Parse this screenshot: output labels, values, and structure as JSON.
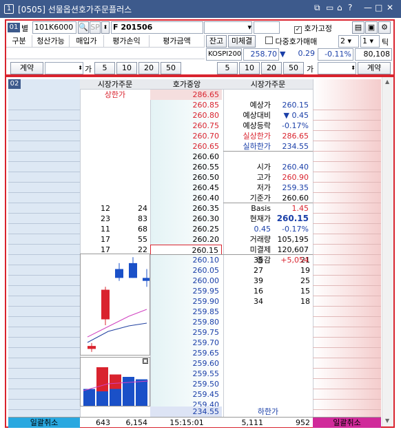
{
  "window": {
    "title": "[0505] 선물옵션호가주문플러스",
    "number": "1"
  },
  "toolbar": {
    "badge": "01",
    "code_label": "별",
    "code_value": "101K6000",
    "contract": "F 201506",
    "hoga_fixed_label": "호가고정",
    "multi_label": "다중호가매매",
    "multi_val1": "2",
    "multi_val2": "1",
    "tick_label": "틱",
    "btn_jango": "잔고",
    "btn_michegyeol": "미체결"
  },
  "summary_headers": [
    "구분",
    "청산가능",
    "매입가",
    "평가손익",
    "평가금액"
  ],
  "kospi": {
    "label": "KOSPI200",
    "value": "258.70",
    "change": "0.29",
    "rate": "-0.11%",
    "volume": "80,108"
  },
  "qty_row": {
    "left_label": "계약",
    "left_unit": "가",
    "qtys": [
      "5",
      "10",
      "20",
      "50"
    ],
    "right_qtys": [
      "5",
      "10",
      "20",
      "50"
    ],
    "right_unit": "가",
    "right_label": "계약"
  },
  "board": {
    "badge": "02",
    "headers": [
      "시장가주문",
      "호가중앙",
      "시장가주문"
    ],
    "upper_limit_label": "상한가",
    "upper_limit": "286.65",
    "lower_limit_label": "하한가",
    "lower_limit": "234.55",
    "prices": [
      "260.85",
      "260.80",
      "260.75",
      "260.70",
      "260.65",
      "260.60",
      "260.55",
      "260.50",
      "260.45",
      "260.40",
      "260.35",
      "260.30",
      "260.25",
      "260.20",
      "260.15",
      "260.10",
      "260.05",
      "260.00",
      "259.95",
      "259.90",
      "259.85",
      "259.80",
      "259.75",
      "259.70",
      "259.65",
      "259.60",
      "259.55",
      "259.50",
      "259.45",
      "259.40"
    ],
    "ask_rows": [
      {
        "cnt": "12",
        "qty": "24"
      },
      {
        "cnt": "23",
        "qty": "83"
      },
      {
        "cnt": "11",
        "qty": "68"
      },
      {
        "cnt": "17",
        "qty": "55"
      },
      {
        "cnt": "17",
        "qty": "22"
      }
    ],
    "bid_rows": [
      {
        "qty": "35",
        "cnt": "21"
      },
      {
        "qty": "27",
        "cnt": "19"
      },
      {
        "qty": "39",
        "cnt": "25"
      },
      {
        "qty": "16",
        "cnt": "15"
      },
      {
        "qty": "34",
        "cnt": "18"
      }
    ],
    "info": [
      {
        "label": "예상가",
        "value": "260.15",
        "color": "#1a3fa8"
      },
      {
        "label": "예상대비",
        "value": "▼ 0.45",
        "color": "#1a3fa8"
      },
      {
        "label": "예상등락",
        "value": "-0.17%",
        "color": "#1a3fa8"
      },
      {
        "label": "실상한가",
        "value": "286.65",
        "color": "#d9232e",
        "lcolor": "#d9232e"
      },
      {
        "label": "실하한가",
        "value": "234.55",
        "color": "#1a3fa8",
        "lcolor": "#1a3fa8"
      },
      {
        "label": "시가",
        "value": "260.40",
        "color": "#1a3fa8"
      },
      {
        "label": "고가",
        "value": "260.90",
        "color": "#d9232e"
      },
      {
        "label": "저가",
        "value": "259.35",
        "color": "#1a3fa8"
      },
      {
        "label": "기준가",
        "value": "260.60",
        "color": "#000"
      },
      {
        "label": "Basis",
        "value": "1.45",
        "color": "#d9232e"
      },
      {
        "label": "현재가",
        "value": "260.15",
        "color": "#1a3fa8"
      },
      {
        "label": "",
        "value": "0.45",
        "value2": "-0.17%",
        "color": "#1a3fa8"
      },
      {
        "label": "거래량",
        "value": "105,195",
        "color": "#000"
      },
      {
        "label": "미결제",
        "value": "120,607",
        "color": "#000"
      },
      {
        "label": "증감",
        "value": "+5,054",
        "color": "#d9232e"
      }
    ],
    "footer": {
      "cancel_left": "일괄취소",
      "ask_total_cnt": "643",
      "ask_total_qty": "6,154",
      "time": "15:15:01",
      "bid_total_qty": "5,111",
      "bid_total_cnt": "952",
      "cancel_right": "일괄취소"
    },
    "current_price": "260.15"
  },
  "candles": [
    {
      "o": 259.4,
      "h": 259.5,
      "l": 259.35,
      "c": 259.45,
      "color": "#d9232e"
    },
    {
      "o": 259.9,
      "h": 260.45,
      "l": 259.8,
      "c": 260.4,
      "color": "#d9232e"
    },
    {
      "o": 260.75,
      "h": 260.85,
      "l": 260.55,
      "c": 260.6,
      "color": "#1a50c8"
    },
    {
      "o": 260.85,
      "h": 260.95,
      "l": 260.6,
      "c": 260.6,
      "color": "#1a50c8"
    },
    {
      "o": 260.6,
      "h": 260.75,
      "l": 260.45,
      "c": 260.55,
      "color": "#1a50c8"
    }
  ],
  "volume_bars": [
    {
      "buy": 0.35,
      "sell": 0.3
    },
    {
      "buy": 0.3,
      "sell": 0.8
    },
    {
      "buy": 0.35,
      "sell": 0.65
    },
    {
      "buy": 0.6,
      "sell": 0.5
    },
    {
      "buy": 0.55,
      "sell": 0.4
    }
  ]
}
